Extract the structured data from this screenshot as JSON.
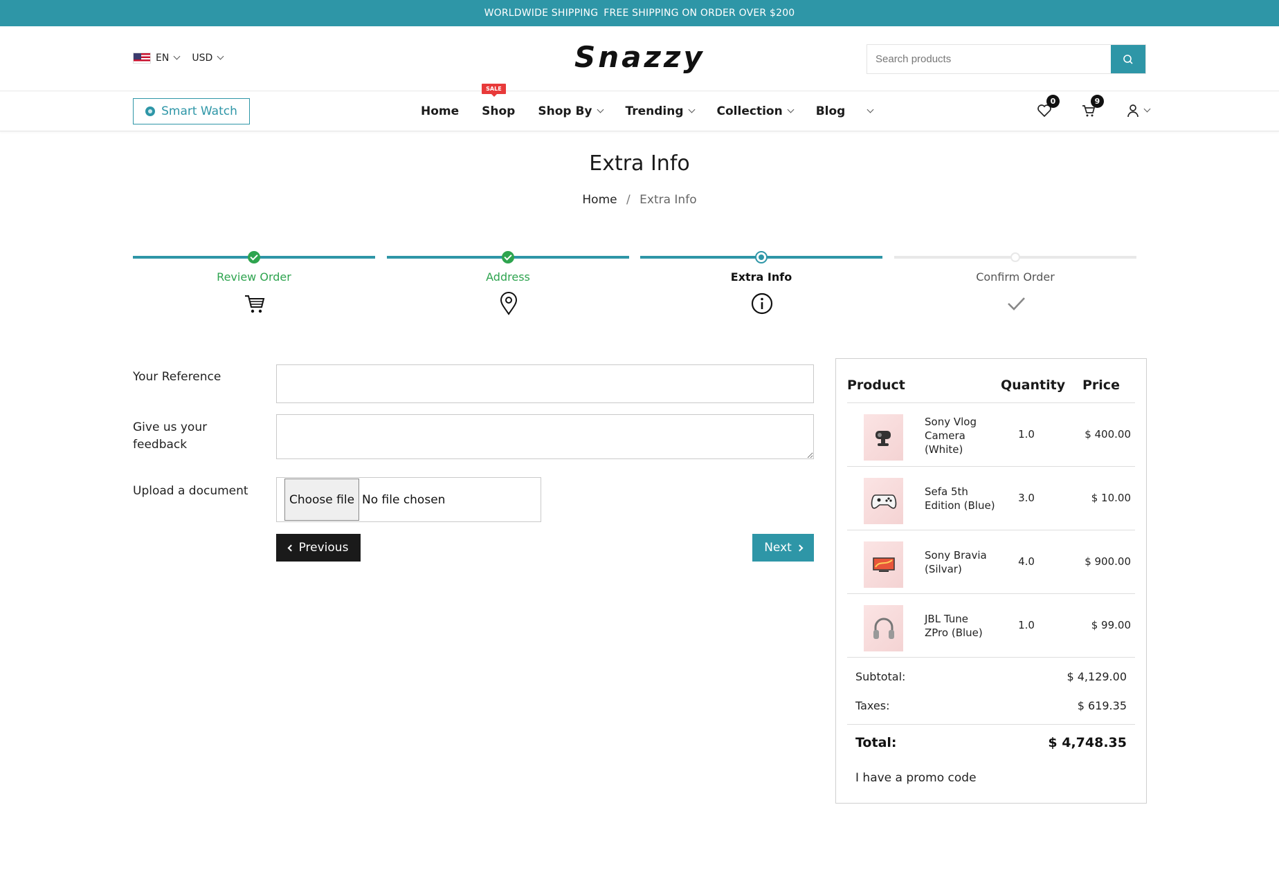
{
  "topbar": {
    "text1": "WORLDWIDE SHIPPING",
    "text2": "FREE SHIPPING ON ORDER OVER $200"
  },
  "header": {
    "language": "EN",
    "currency": "USD",
    "logo": "Snazzy",
    "search_placeholder": "Search products"
  },
  "nav": {
    "category_button": "Smart Watch",
    "sale_badge": "SALE",
    "items": [
      {
        "label": "Home"
      },
      {
        "label": "Shop"
      },
      {
        "label": "Shop By"
      },
      {
        "label": "Trending"
      },
      {
        "label": "Collection"
      },
      {
        "label": "Blog"
      }
    ],
    "wishlist_count": "0",
    "cart_count": "9"
  },
  "page": {
    "title": "Extra Info",
    "breadcrumb_home": "Home",
    "breadcrumb_sep": "/",
    "breadcrumb_current": "Extra Info"
  },
  "wizard": {
    "steps": [
      {
        "label": "Review Order",
        "state": "done"
      },
      {
        "label": "Address",
        "state": "done"
      },
      {
        "label": "Extra Info",
        "state": "active"
      },
      {
        "label": "Confirm Order",
        "state": "pending"
      }
    ]
  },
  "form": {
    "reference_label": "Your Reference",
    "reference_value": "",
    "feedback_label_line1": "Give us your",
    "feedback_label_line2": "feedback",
    "feedback_value": "",
    "upload_label": "Upload a document",
    "file_button": "Choose file",
    "file_status": "No file chosen",
    "previous": "Previous",
    "next": "Next"
  },
  "summary": {
    "col_product": "Product",
    "col_quantity": "Quantity",
    "col_price": "Price",
    "items": [
      {
        "name_l1": "Sony Vlog",
        "name_l2": "Camera",
        "name_l3": "(White)",
        "qty": "1.0",
        "price": "$ 400.00"
      },
      {
        "name_l1": "Sefa 5th",
        "name_l2": "Edition (Blue)",
        "name_l3": "",
        "qty": "3.0",
        "price": "$ 10.00"
      },
      {
        "name_l1": "Sony Bravia",
        "name_l2": "(Silvar)",
        "name_l3": "",
        "qty": "4.0",
        "price": "$ 900.00"
      },
      {
        "name_l1": "JBL Tune",
        "name_l2": "ZPro (Blue)",
        "name_l3": "",
        "qty": "1.0",
        "price": "$ 99.00"
      }
    ],
    "subtotal_label": "Subtotal:",
    "subtotal_value": "$ 4,129.00",
    "taxes_label": "Taxes:",
    "taxes_value": "$ 619.35",
    "total_label": "Total:",
    "total_value": "$ 4,748.35",
    "promo": "I have a promo code"
  },
  "colors": {
    "accent": "#2e96a7",
    "done": "#2ea44f",
    "sale": "#e83a3a",
    "dark": "#1a1a1a"
  }
}
